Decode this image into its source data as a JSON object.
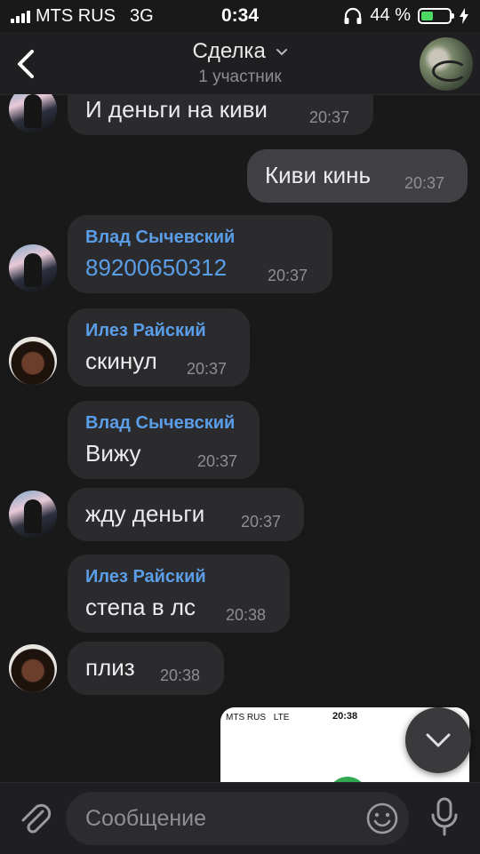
{
  "status_bar": {
    "carrier": "MTS RUS",
    "network": "3G",
    "time": "0:34",
    "battery": "44 %",
    "battery_level": 0.44,
    "battery_color": "#4cd964"
  },
  "header": {
    "title": "Сделка",
    "subtitle": "1 участник"
  },
  "messages": [
    {
      "sender": "",
      "text": "И деньги на киви",
      "time": "20:37",
      "outgoing": false,
      "avatar": "vlad"
    },
    {
      "sender": "",
      "text": "Киви кинь",
      "time": "20:37",
      "outgoing": true
    },
    {
      "sender": "Влад Сычевский",
      "text": "89200650312",
      "time": "20:37",
      "outgoing": false,
      "avatar": "vlad",
      "is_link": true
    },
    {
      "sender": "Илез Райский",
      "text": "скинул",
      "time": "20:37",
      "outgoing": false,
      "avatar": "ilez"
    },
    {
      "sender": "Влад Сычевский",
      "text": "Вижу",
      "time": "20:37",
      "outgoing": false,
      "avatar": "none"
    },
    {
      "sender": "",
      "text": "жду деньги",
      "time": "20:37",
      "outgoing": false,
      "avatar": "vlad"
    },
    {
      "sender": "Илез Райский",
      "text": "степа в лс",
      "time": "20:38",
      "outgoing": false,
      "avatar": "none"
    },
    {
      "sender": "",
      "text": "плиз",
      "time": "20:38",
      "outgoing": false,
      "avatar": "ilez"
    }
  ],
  "screenshot_preview": {
    "carrier": "MTS RUS",
    "network": "LTE",
    "time": "20:38"
  },
  "input": {
    "placeholder": "Сообщение"
  },
  "colors": {
    "accent": "#5b9ee8",
    "background": "#19191a",
    "bubble_in": "#2b2b2e",
    "bubble_out": "#414145"
  },
  "icons": {
    "back": "chevron-left-icon",
    "title_dropdown": "chevron-down-icon",
    "scroll_down": "chevron-down-icon",
    "attach": "paperclip-icon",
    "emoji": "smile-icon",
    "voice": "microphone-icon"
  }
}
